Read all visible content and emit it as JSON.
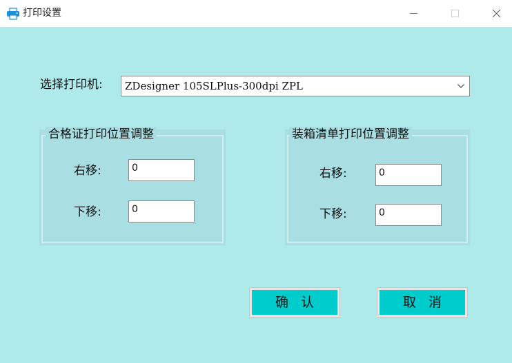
{
  "window": {
    "title": "打印设置",
    "icon": "printer-icon",
    "controls": [
      "minimize-icon",
      "maximize-icon",
      "close-icon"
    ]
  },
  "printer": {
    "label": "选择打印机:",
    "selected": "ZDesigner 105SLPlus-300dpi ZPL"
  },
  "certificate_group": {
    "title": "合格证打印位置调整",
    "right_label": "右移:",
    "right_value": "0",
    "down_label": "下移:",
    "down_value": "0"
  },
  "packing_group": {
    "title": "装箱清单打印位置调整",
    "right_label": "右移:",
    "right_value": "0",
    "down_label": "下移:",
    "down_value": "0"
  },
  "buttons": {
    "confirm": "确认",
    "cancel": "取消"
  },
  "colors": {
    "background": "#aeeaea",
    "group_background": "#a9dfe3",
    "button_face": "#00cccc",
    "icon_blue": "#1e8fd6"
  }
}
